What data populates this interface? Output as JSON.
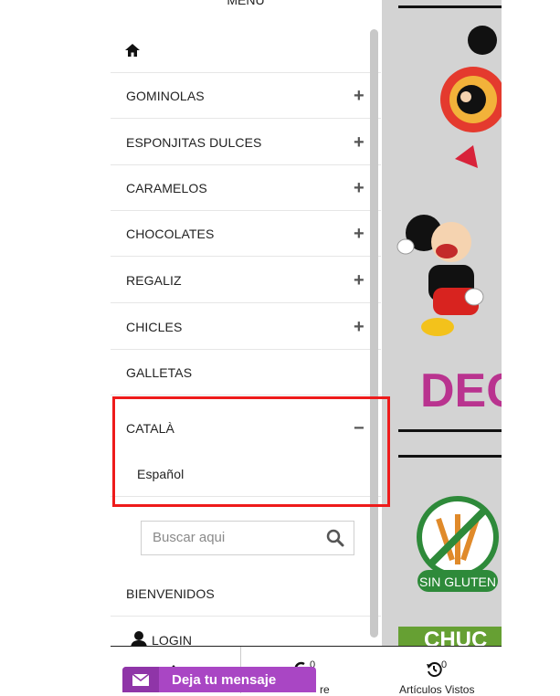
{
  "menu": {
    "title": "MENU",
    "items": [
      {
        "label": "GOMINOLAS",
        "expand": "+"
      },
      {
        "label": "ESPONJITAS DULCES",
        "expand": "+"
      },
      {
        "label": "CARAMELOS",
        "expand": "+"
      },
      {
        "label": "CHOCOLATES",
        "expand": "+"
      },
      {
        "label": "REGALIZ",
        "expand": "+"
      },
      {
        "label": "CHICLES",
        "expand": "+"
      },
      {
        "label": "GALLETAS"
      }
    ],
    "language": {
      "label": "CATALÀ",
      "collapse": "−",
      "option": "Español"
    },
    "search_placeholder": "Buscar aqui",
    "welcome": "BIENVENIDOS",
    "login": "LOGIN"
  },
  "bottom_bar": {
    "left_count": "0",
    "left_label_fragment": "re",
    "right_count": "0",
    "right_label": "Artículos Vistos"
  },
  "message_button": {
    "label": "Deja tu mensaje"
  },
  "background": {
    "banner_fragment": "DEC",
    "badge_text": "SIN GLUTEN",
    "bottom_fragment": "CHUC"
  },
  "colors": {
    "highlight": "#ee1b1b",
    "message_button": "#a946c4",
    "decor_text": "#b9338f",
    "gluten_green": "#2e8a3a"
  }
}
